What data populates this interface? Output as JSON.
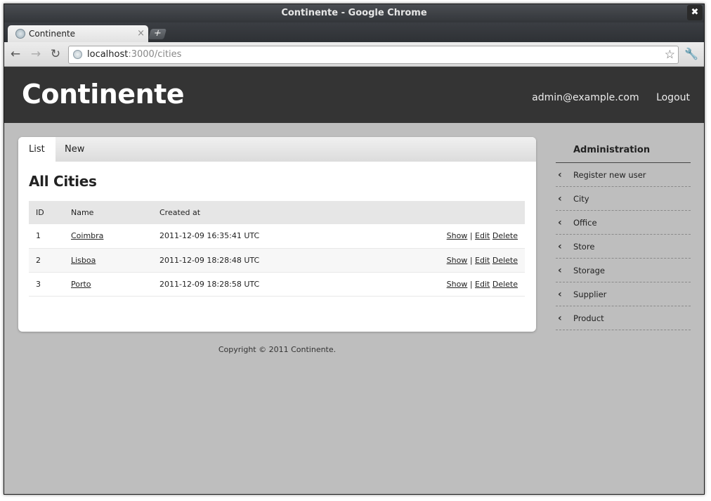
{
  "browser": {
    "window_title": "Continente - Google Chrome",
    "close_symbol": "✖",
    "tab_title": "Continente",
    "tab_close": "×",
    "new_tab": "+",
    "url_host": "localhost",
    "url_path": ":3000/cities"
  },
  "header": {
    "site_title": "Continente",
    "user_email": "admin@example.com",
    "logout": "Logout"
  },
  "panel": {
    "tabs": [
      "List",
      "New"
    ],
    "heading": "All Cities",
    "columns": [
      "ID",
      "Name",
      "Created at"
    ],
    "rows": [
      {
        "id": "1",
        "name": "Coimbra",
        "created_at": "2011-12-09 16:35:41 UTC"
      },
      {
        "id": "2",
        "name": "Lisboa",
        "created_at": "2011-12-09 18:28:48 UTC"
      },
      {
        "id": "3",
        "name": "Porto",
        "created_at": "2011-12-09 18:28:58 UTC"
      }
    ],
    "actions": {
      "show": "Show",
      "separator": "|",
      "edit": "Edit",
      "delete": "Delete"
    }
  },
  "footer": {
    "copyright": "Copyright © 2011 Continente."
  },
  "sidebar": {
    "title": "Administration",
    "items": [
      "Register new user",
      "City",
      "Office",
      "Store",
      "Storage",
      "Supplier",
      "Product"
    ]
  },
  "colors": {
    "header_bg": "#343434",
    "page_bg": "#bebebe",
    "panel_bg": "#ffffff"
  },
  "icons": {
    "back": "back-arrow-icon",
    "forward": "forward-arrow-icon",
    "reload": "reload-icon",
    "bookmark": "star-icon",
    "menu": "wrench-icon",
    "sidebar_item": "chevron-left-icon"
  }
}
